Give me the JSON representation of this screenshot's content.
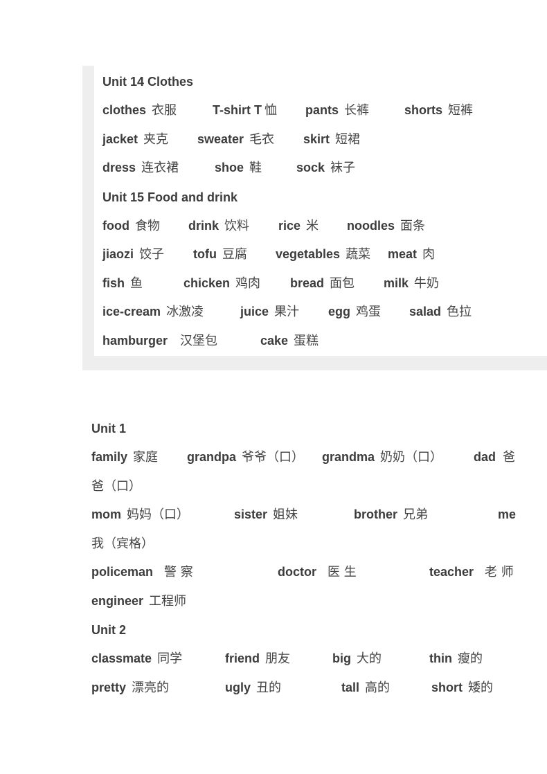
{
  "section_a": {
    "unit14": {
      "title": "Unit 14 Clothes",
      "rows": [
        [
          {
            "en": "clothes",
            "zh": "衣服"
          },
          {
            "en": "T-shirt T",
            "zh": "恤"
          },
          {
            "en": "pants",
            "zh": "长裤"
          },
          {
            "en": "shorts",
            "zh": "短裤"
          }
        ],
        [
          {
            "en": "jacket",
            "zh": "夹克"
          },
          {
            "en": "sweater",
            "zh": "毛衣"
          },
          {
            "en": "skirt",
            "zh": "短裙"
          }
        ],
        [
          {
            "en": "dress",
            "zh": "连衣裙"
          },
          {
            "en": "shoe",
            "zh": "鞋"
          },
          {
            "en": "sock",
            "zh": "袜子"
          }
        ]
      ]
    },
    "unit15": {
      "title": "Unit 15 Food and drink",
      "rows": [
        [
          {
            "en": "food",
            "zh": "食物"
          },
          {
            "en": "drink",
            "zh": "饮料"
          },
          {
            "en": "rice",
            "zh": "米"
          },
          {
            "en": "noodles",
            "zh": "面条"
          }
        ],
        [
          {
            "en": "jiaozi",
            "zh": "饺子"
          },
          {
            "en": "tofu",
            "zh": "豆腐"
          },
          {
            "en": "vegetables",
            "zh": "蔬菜"
          },
          {
            "en": "meat",
            "zh": "肉"
          }
        ],
        [
          {
            "en": "fish",
            "zh": "鱼"
          },
          {
            "en": "chicken",
            "zh": "鸡肉"
          },
          {
            "en": "bread",
            "zh": "面包"
          },
          {
            "en": "milk",
            "zh": "牛奶"
          }
        ],
        [
          {
            "en": "ice-cream",
            "zh": "冰激凌"
          },
          {
            "en": "juice",
            "zh": "果汁"
          },
          {
            "en": "egg",
            "zh": "鸡蛋"
          },
          {
            "en": "salad",
            "zh": "色拉"
          }
        ],
        [
          {
            "en": "hamburger",
            "zh": "汉堡包"
          },
          {
            "en": "cake",
            "zh": "蛋糕"
          }
        ]
      ]
    }
  },
  "section_b": {
    "unit1": {
      "title": "Unit 1",
      "rows": [
        [
          {
            "en": "family",
            "zh": "家庭"
          },
          {
            "en": "grandpa",
            "zh": "爷爷（口）"
          },
          {
            "en": "grandma",
            "zh": "奶奶（口）"
          },
          {
            "en": "dad",
            "zh": "爸"
          }
        ],
        [
          {
            "zh": "爸（口）"
          }
        ],
        [
          {
            "en": "mom",
            "zh": "妈妈（口）"
          },
          {
            "en": "sister",
            "zh": "姐妹"
          },
          {
            "en": "brother",
            "zh": "兄弟"
          },
          {
            "en": "me"
          }
        ],
        [
          {
            "zh": "我（宾格）"
          }
        ],
        [
          {
            "en": "policeman",
            "zh": "警 察"
          },
          {
            "en": "doctor",
            "zh": "医 生"
          },
          {
            "en": "teacher",
            "zh": "老 师"
          }
        ],
        [
          {
            "en": "engineer",
            "zh": "工程师"
          }
        ]
      ]
    },
    "unit2": {
      "title": "Unit 2",
      "rows": [
        [
          {
            "en": "classmate",
            "zh": "同学"
          },
          {
            "en": "friend",
            "zh": "朋友"
          },
          {
            "en": "big",
            "zh": "大的"
          },
          {
            "en": "thin",
            "zh": "瘦的"
          }
        ],
        [
          {
            "en": "pretty",
            "zh": "漂亮的"
          },
          {
            "en": "ugly",
            "zh": "丑的"
          },
          {
            "en": "tall",
            "zh": "高的"
          },
          {
            "en": "short",
            "zh": "矮的"
          }
        ]
      ]
    }
  }
}
